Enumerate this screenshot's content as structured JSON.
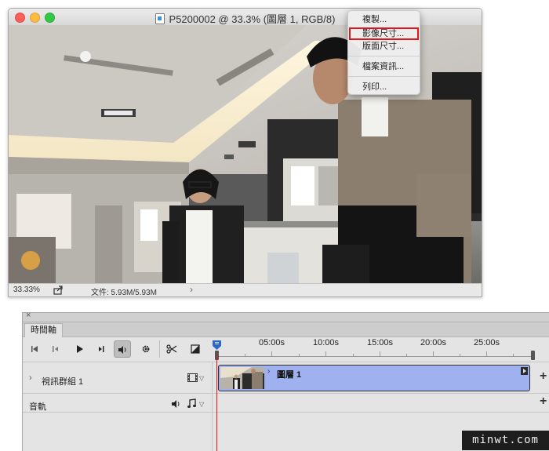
{
  "document": {
    "title": "P5200002 @ 33.3% (圖層 1, RGB/8)",
    "zoom": "33.33%",
    "file_info": "文件: 5.93M/5.93M",
    "status_chevron": "›"
  },
  "context_menu": {
    "items": [
      "複製...",
      "影像尺寸...",
      "版面尺寸...",
      "檔案資訊...",
      "列印..."
    ],
    "highlighted_index": 1
  },
  "timeline": {
    "close_glyph": "×",
    "tab": "時間軸",
    "ruler_labels": [
      "05:00s",
      "10:00s",
      "15:00s",
      "20:00s",
      "25:00s"
    ],
    "video_group_label": "視訊群組 1",
    "audio_track_label": "音軌",
    "clip_name": "圖層 1",
    "add_symbol": "+"
  },
  "icons": {
    "traffic_lights": [
      "close",
      "minimize",
      "zoom"
    ],
    "status_bar": "export-icon",
    "transport": [
      "go-to-first-frame-icon",
      "previous-frame-icon",
      "play-icon",
      "next-frame-icon",
      "audio-icon",
      "settings-gear-icon",
      "scissors-icon",
      "transition-icon"
    ],
    "tracks": [
      "film-strip-icon",
      "speaker-icon",
      "music-note-icon"
    ]
  },
  "colors": {
    "highlight_outline": "#e0161d",
    "clip_fill": "#9fb2ef",
    "playhead": "#e0161d",
    "playhead_head": "#2d67c7"
  },
  "watermark": "minwt.com"
}
